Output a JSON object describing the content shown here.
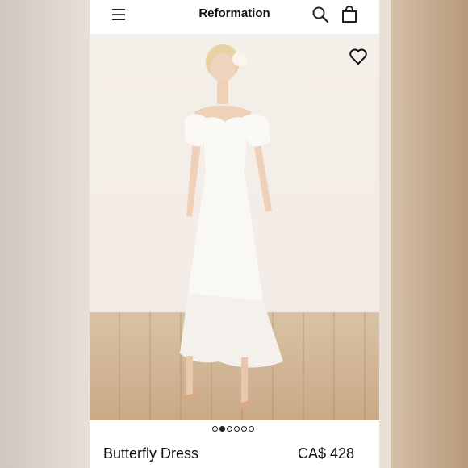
{
  "header": {
    "brand": "Reformation",
    "icons": [
      "menu-icon",
      "search-icon",
      "shopping-bag-icon"
    ]
  },
  "hero": {
    "favorite_icon": "heart-icon"
  },
  "carousel": {
    "total": 6,
    "active_index": 1
  },
  "product": {
    "name": "Butterfly Dress",
    "price": "CA$ 428"
  },
  "colors": {
    "background": "#ffffff",
    "text": "#111111",
    "dress": "#fbf9f6",
    "floor": "#c9a987"
  }
}
